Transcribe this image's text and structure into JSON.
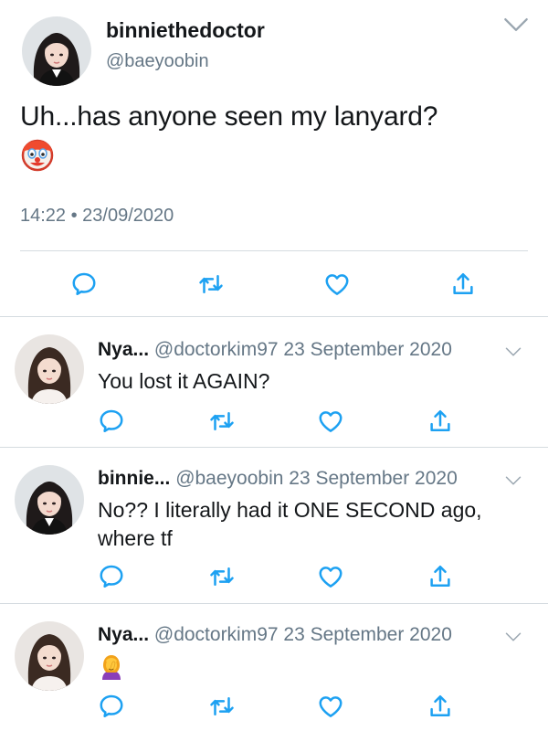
{
  "main_tweet": {
    "display_name": "binniethedoctor",
    "handle": "@baeyoobin",
    "text": "Uh...has anyone seen my lanyard?",
    "emoji": "clown-face",
    "timestamp": "14:22 • 23/09/2020"
  },
  "replies": [
    {
      "name": "Nya...",
      "handle": "@doctorkim97",
      "date": "23 September 2020",
      "text": "You lost it AGAIN?",
      "emoji": ""
    },
    {
      "name": "binnie...",
      "handle": "@baeyoobin",
      "date": "23 September 2020",
      "text": "No?? I literally had it ONE SECOND ago, where tf",
      "emoji": ""
    },
    {
      "name": "Nya...",
      "handle": "@doctorkim97",
      "date": "23 September 2020",
      "text": "",
      "emoji": "person-facepalming"
    }
  ],
  "colors": {
    "text": "#14171a",
    "secondary": "#657786",
    "divider": "#d5dbe0",
    "icon": "#1da1f2"
  },
  "icons": [
    "reply-icon",
    "retweet-icon",
    "like-icon",
    "share-icon",
    "chevron-down-icon"
  ]
}
